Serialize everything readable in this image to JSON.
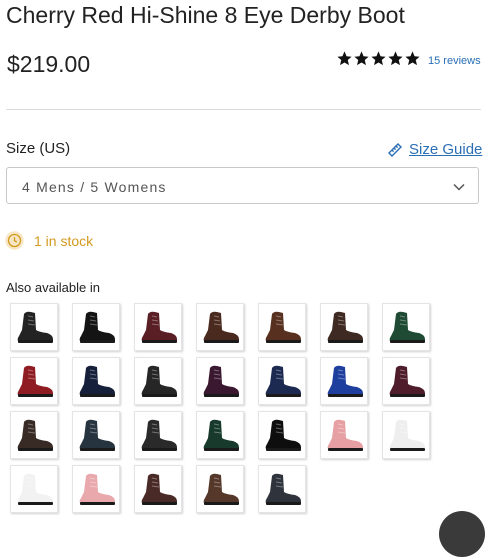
{
  "product": {
    "title": "Cherry Red Hi-Shine 8 Eye Derby Boot",
    "price": "$219.00",
    "rating": 5,
    "rating_max": 5,
    "reviews_label": "15 reviews"
  },
  "size": {
    "label": "Size (US)",
    "guide_label": "Size Guide",
    "selected": "4 Mens / 5 Womens"
  },
  "stock": {
    "text": "1 in stock"
  },
  "also_available": {
    "label": "Also available in",
    "swatches": [
      {
        "color": "#232323"
      },
      {
        "color": "#141414"
      },
      {
        "color": "#5a1f24"
      },
      {
        "color": "#4a2a1e"
      },
      {
        "color": "#57301f"
      },
      {
        "color": "#3e2a22"
      },
      {
        "color": "#1f4a34"
      },
      {
        "color": "#8e1c22"
      },
      {
        "color": "#16203a"
      },
      {
        "color": "#262626"
      },
      {
        "color": "#3a1830"
      },
      {
        "color": "#1c2a52"
      },
      {
        "color": "#1f3f9e"
      },
      {
        "color": "#4e1c2a"
      },
      {
        "color": "#382b26"
      },
      {
        "color": "#263440"
      },
      {
        "color": "#2a2a2a"
      },
      {
        "color": "#173a2c"
      },
      {
        "color": "#0e0e0e"
      },
      {
        "color": "#e6a0a4"
      },
      {
        "color": "#eeeeee"
      },
      {
        "color": "#f2f2f2"
      },
      {
        "color": "#e8a8ac"
      },
      {
        "color": "#4a2a26"
      },
      {
        "color": "#55382a"
      },
      {
        "color": "#2f333c"
      }
    ]
  },
  "colors": {
    "link": "#2a6fb5",
    "stock": "#d39a1e"
  }
}
